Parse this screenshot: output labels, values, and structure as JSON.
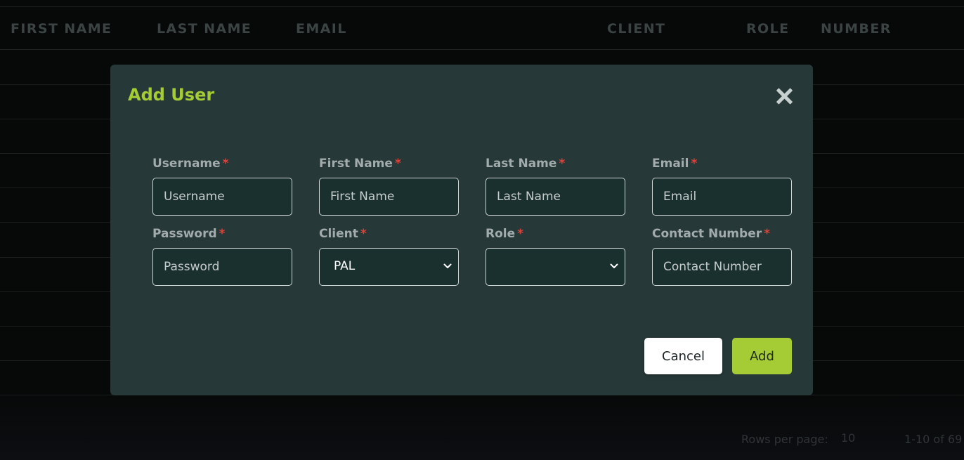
{
  "table": {
    "columns": [
      "FIRST NAME",
      "LAST NAME",
      "EMAIL",
      "CLIENT",
      "ROLE",
      "NUMBER"
    ],
    "footer": {
      "rows_per_page_label": "Rows per page:",
      "rows_per_page_value": "10",
      "range_text": "1-10 of 69"
    }
  },
  "modal": {
    "title": "Add User",
    "required_marker": "*",
    "fields": {
      "username": {
        "label": "Username",
        "placeholder": "Username"
      },
      "first_name": {
        "label": "First Name",
        "placeholder": "First Name"
      },
      "last_name": {
        "label": "Last Name",
        "placeholder": "Last Name"
      },
      "email": {
        "label": "Email",
        "placeholder": "Email"
      },
      "password": {
        "label": "Password",
        "placeholder": "Password"
      },
      "client": {
        "label": "Client",
        "selected": "PAL"
      },
      "role": {
        "label": "Role",
        "selected": ""
      },
      "contact_number": {
        "label": "Contact Number",
        "placeholder": "Contact Number"
      }
    },
    "buttons": {
      "cancel_label": "Cancel",
      "add_label": "Add"
    }
  },
  "colors": {
    "accent": "#a6cc35",
    "required": "#e0413a",
    "modal_bg": "#263837"
  }
}
